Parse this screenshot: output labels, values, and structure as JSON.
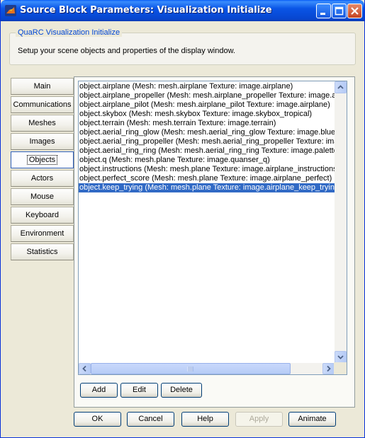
{
  "window": {
    "title": "Source Block Parameters: Visualization Initialize"
  },
  "group": {
    "title": "QuaRC Visualization Initialize",
    "description": "Setup your scene objects and properties of the display window."
  },
  "tabs": [
    {
      "label": "Main"
    },
    {
      "label": "Communications"
    },
    {
      "label": "Meshes"
    },
    {
      "label": "Images"
    },
    {
      "label": "Objects",
      "active": true
    },
    {
      "label": "Actors"
    },
    {
      "label": "Mouse"
    },
    {
      "label": "Keyboard"
    },
    {
      "label": "Environment"
    },
    {
      "label": "Statistics"
    }
  ],
  "objects_list": {
    "items": [
      "object.airplane (Mesh: mesh.airplane  Texture: image.airplane)",
      "object.airplane_propeller (Mesh: mesh.airplane_propeller  Texture: image.ai",
      "object.airplane_pilot (Mesh: mesh.airplane_pilot  Texture: image.airplane)",
      "object.skybox (Mesh: mesh.skybox  Texture: image.skybox_tropical)",
      "object.terrain (Mesh: mesh.terrain  Texture: image.terrain)",
      "object.aerial_ring_glow (Mesh: mesh.aerial_ring_glow  Texture: image.blue",
      "object.aerial_ring_propeller (Mesh: mesh.aerial_ring_propeller  Texture: ima",
      "object.aerial_ring_ring (Mesh: mesh.aerial_ring_ring  Texture: image.palette",
      "object.q (Mesh: mesh.plane  Texture: image.quanser_q)",
      "object.instructions (Mesh: mesh.plane  Texture: image.airplane_instructions",
      "object.perfect_score (Mesh: mesh.plane  Texture: image.airplane_perfect)",
      "object.keep_trying (Mesh: mesh.plane  Texture: image.airplane_keep_trying"
    ],
    "selected_index": 11
  },
  "list_buttons": {
    "add": "Add",
    "edit": "Edit",
    "delete": "Delete"
  },
  "dialog_buttons": {
    "ok": "OK",
    "cancel": "Cancel",
    "help": "Help",
    "apply": "Apply",
    "animate": "Animate"
  },
  "icons": {
    "app": "matlab-icon",
    "minimize": "minimize-icon",
    "maximize": "maximize-icon",
    "close": "close-icon"
  },
  "colors": {
    "titlebar": "#0a55e6",
    "selection": "#316ac5",
    "group_title": "#0046d5"
  }
}
